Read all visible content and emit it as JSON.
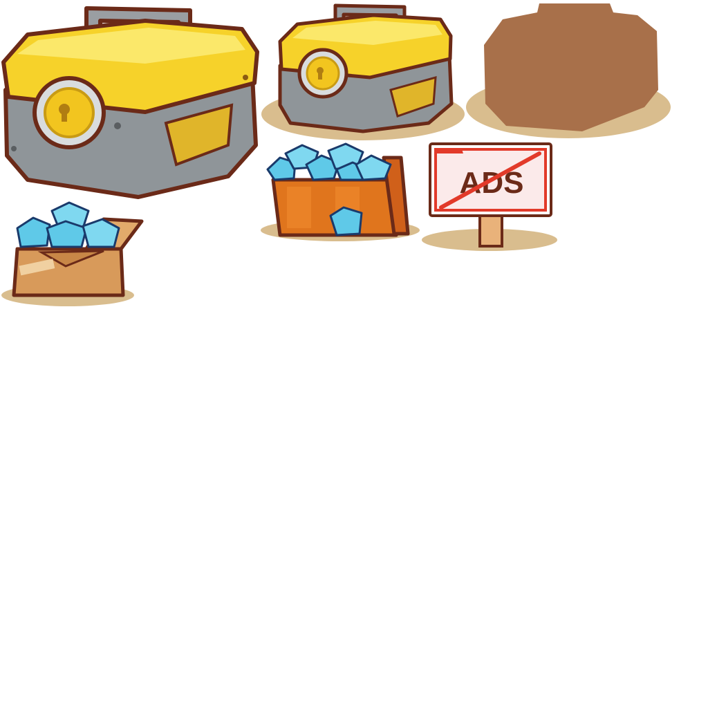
{
  "sheet": {
    "background": "#ffffff"
  },
  "sprites": [
    {
      "name": "chest-large",
      "icon": "locked-chest-icon"
    },
    {
      "name": "chest-small",
      "icon": "locked-chest-icon"
    },
    {
      "name": "chest-silhouette",
      "icon": "chest-silhouette-icon"
    },
    {
      "name": "gem-crate",
      "icon": "gem-crate-icon"
    },
    {
      "name": "no-ads-sign",
      "icon": "no-ads-sign-icon",
      "label": "ADS"
    },
    {
      "name": "gem-box",
      "icon": "gem-box-icon"
    }
  ],
  "colors": {
    "chest_lid_yellow": "#f6d22a",
    "chest_lid_highlight": "#fbe86a",
    "chest_body_gray": "#8f9599",
    "chest_outline": "#6b2a18",
    "lock_yellow": "#f2c51f",
    "handle_gray": "#9a9ea2",
    "shadow_tan": "#d9bd8e",
    "silhouette_brown": "#a8704a",
    "gem_blue": "#5fc9e8",
    "crate_orange": "#e0751d",
    "box_tan": "#d89a5a",
    "sign_red": "#e23a2a"
  }
}
